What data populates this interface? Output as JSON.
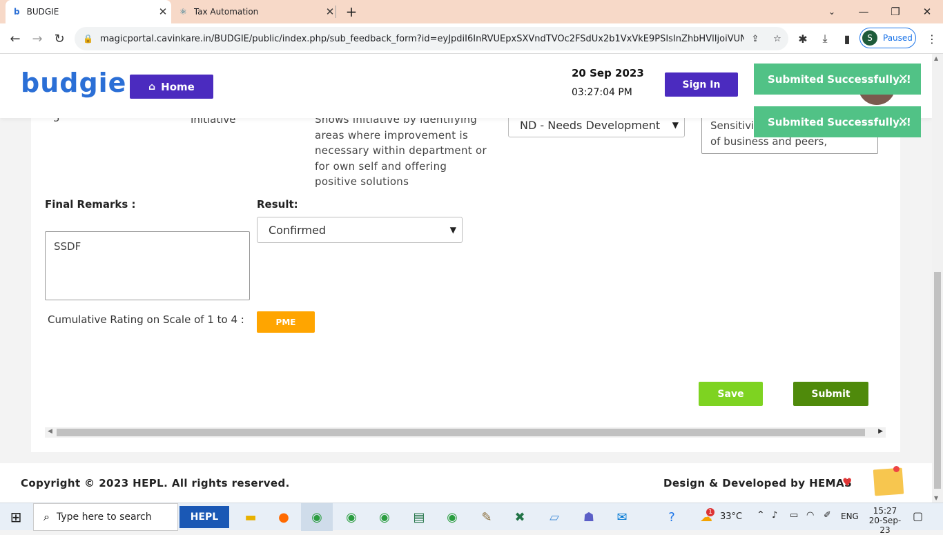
{
  "browser": {
    "tabs": [
      {
        "title": "BUDGIE",
        "active": true
      },
      {
        "title": "Tax Automation",
        "active": false
      }
    ],
    "new_tab": "+",
    "url": "magicportal.cavinkare.in/BUDGIE/public/index.php/sub_feedback_form?id=eyJpdiI6InRVUEpxSXVndTVOc2FSdUx2b1VxVkE9PSIsInZhbHVlIjoiVUNqeV...",
    "profile": {
      "initial": "S",
      "status": "Paused"
    }
  },
  "header": {
    "logo_text": "budgie",
    "home_label": "Home",
    "date": "20 Sep 2023",
    "time": "03:27:04 PM",
    "signin_label": "Sign In"
  },
  "row": {
    "number": "5",
    "competency": "Initiative",
    "description_lines": [
      "Shows initiative by identifying",
      "areas where improvement is",
      "necessary within department or",
      "for own self and offering",
      "positive solutions"
    ],
    "rating_select": "ND - Needs Development",
    "comment_lines": [
      "Sensitivi",
      "of business and peers,"
    ]
  },
  "form": {
    "final_remarks_label": "Final Remarks :",
    "final_remarks_value": "SSDF",
    "result_label": "Result:",
    "result_value": "Confirmed",
    "cumulative_label": "Cumulative Rating on Scale of 1 to 4 :",
    "cumulative_value": "PME",
    "save_label": "Save",
    "submit_label": "Submit"
  },
  "toasts": [
    {
      "message": "Submited Successfully..!"
    },
    {
      "message": "Submited Successfully..!"
    }
  ],
  "footer": {
    "copyright": "Copyright © 2023 HEPL. All rights reserved.",
    "credit": "Design & Developed by HEMAS"
  },
  "taskbar": {
    "search_placeholder": "Type here to search",
    "temperature": "33°C",
    "language": "ENG",
    "clock_time": "15:27",
    "clock_date": "20-Sep-23",
    "weather_badge": "1"
  },
  "colors": {
    "accent": "#4b2bbf",
    "toast": "#51c286",
    "save": "#7ed321",
    "submit": "#4f8a0b",
    "pme": "#ffa500"
  }
}
